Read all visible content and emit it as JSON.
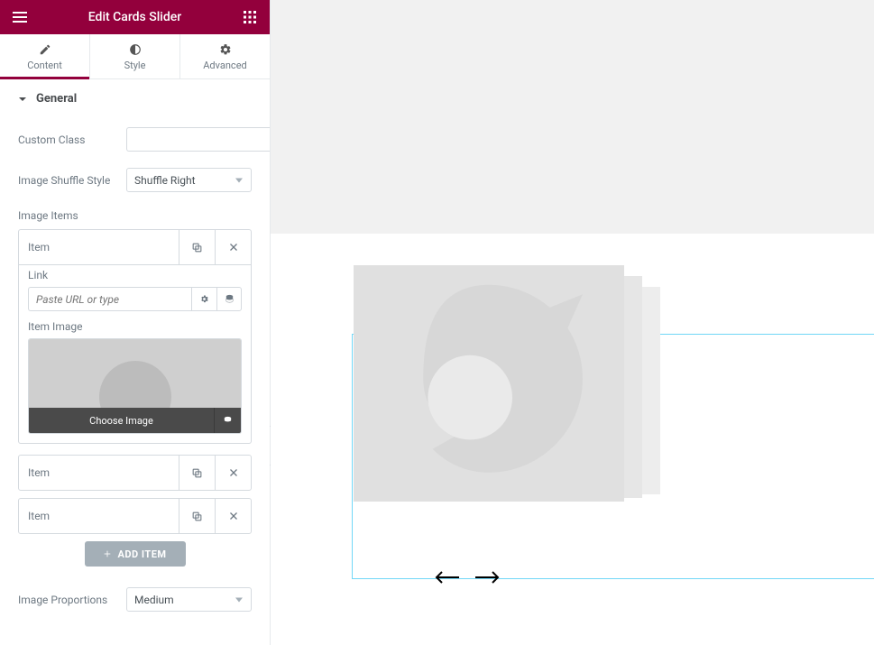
{
  "header": {
    "title": "Edit Cards Slider"
  },
  "tabs": {
    "content": "Content",
    "style": "Style",
    "advanced": "Advanced"
  },
  "section": {
    "general": "General"
  },
  "fields": {
    "custom_class_label": "Custom Class",
    "custom_class_value": "",
    "image_shuffle_label": "Image Shuffle Style",
    "image_shuffle_value": "Shuffle Right",
    "image_items_label": "Image Items",
    "image_proportions_label": "Image Proportions",
    "image_proportions_value": "Medium"
  },
  "items": [
    {
      "name": "Item",
      "expanded": true
    },
    {
      "name": "Item",
      "expanded": false
    },
    {
      "name": "Item",
      "expanded": false
    }
  ],
  "item_body": {
    "link_label": "Link",
    "link_placeholder": "Paste URL or type",
    "item_image_label": "Item Image",
    "choose_image": "Choose Image"
  },
  "buttons": {
    "add_item": "ADD ITEM"
  }
}
